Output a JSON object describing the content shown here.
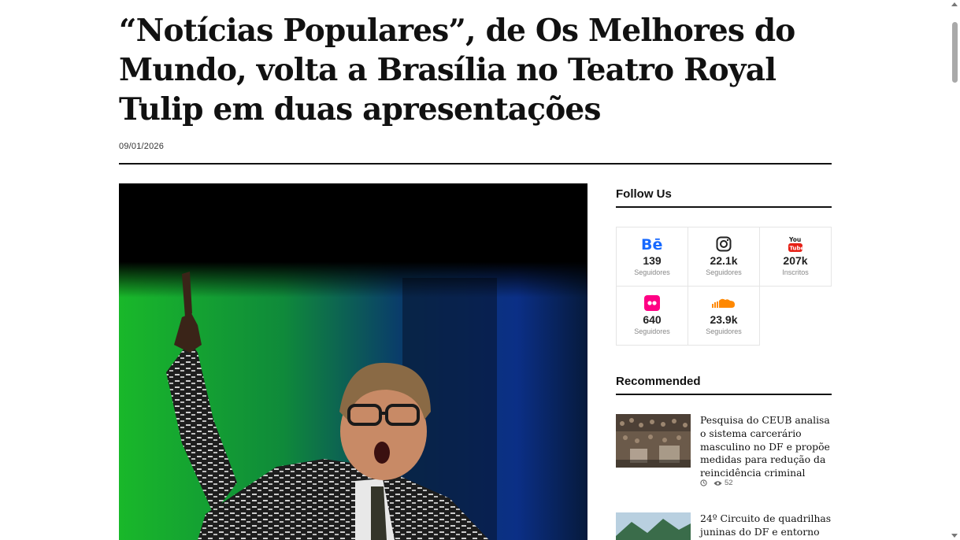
{
  "article": {
    "title": "“Notícias Populares”, de Os Melhores do Mundo, volta a Brasília no Teatro Royal Tulip em duas apresentações",
    "date": "09/01/2026"
  },
  "sidebar": {
    "follow_title": "Follow Us",
    "social": [
      {
        "icon": "behance-icon",
        "count": "139",
        "label": "Seguidores",
        "color": "#1769ff"
      },
      {
        "icon": "instagram-icon",
        "count": "22.1k",
        "label": "Seguidores",
        "color": "#222222"
      },
      {
        "icon": "youtube-icon",
        "count": "207k",
        "label": "Inscritos",
        "color": "#e62117"
      },
      {
        "icon": "flickr-icon",
        "count": "640",
        "label": "Seguidores",
        "color": "#ff0084"
      },
      {
        "icon": "soundcloud-icon",
        "count": "23.9k",
        "label": "Seguidores",
        "color": "#ff8800"
      }
    ],
    "recommended_title": "Recommended",
    "recommended": [
      {
        "title": "Pesquisa do CEUB analisa o sistema carcerário masculino no DF e propõe medidas para redução da reincidência criminal",
        "views": "52"
      },
      {
        "title": "24º Circuito de quadrilhas juninas do DF e entorno"
      }
    ]
  },
  "colors": {
    "accent": "#111111",
    "border": "#e5e5e5"
  }
}
